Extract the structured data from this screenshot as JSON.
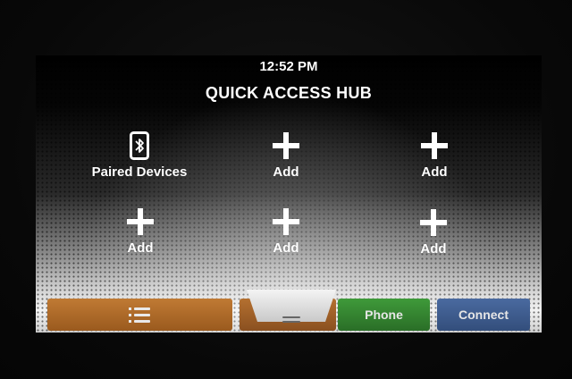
{
  "status": {
    "time": "12:52 PM"
  },
  "page": {
    "title": "QUICK ACCESS HUB"
  },
  "tiles": [
    {
      "label": "Paired Devices",
      "icon": "bluetooth-icon"
    },
    {
      "label": "Add",
      "icon": "plus-icon"
    },
    {
      "label": "Add",
      "icon": "plus-icon"
    },
    {
      "label": "Add",
      "icon": "plus-icon"
    },
    {
      "label": "Add",
      "icon": "plus-icon"
    },
    {
      "label": "Add",
      "icon": "plus-icon"
    }
  ],
  "bottom_bar": {
    "menu_icon": "menu-list-icon",
    "handle_icon": "drag-handle-icon",
    "phone_label": "Phone",
    "connect_label": "Connect"
  },
  "colors": {
    "menu_orange": "#b06b2a",
    "phone_green": "#3a8a35",
    "connect_blue": "#42609a"
  }
}
